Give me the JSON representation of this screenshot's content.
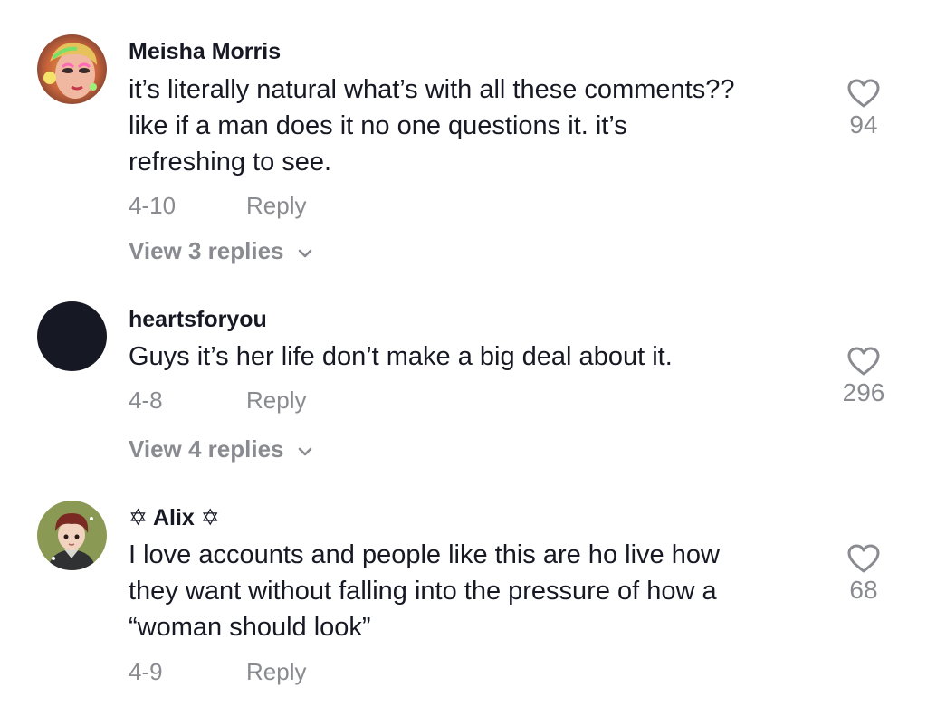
{
  "comments": [
    {
      "username": "Meisha Morris",
      "text": "it’s literally natural what’s with all these comments??\nlike if a man does it no one questions it. it’s\nrefreshing to see.",
      "date": "4-10",
      "reply_label": "Reply",
      "view_replies": "View 3 replies",
      "likes": "94"
    },
    {
      "username": "heartsforyou",
      "text": "Guys it’s her life don’t make a big deal about it.",
      "date": "4-8",
      "reply_label": "Reply",
      "view_replies": "View 4 replies",
      "likes": "296"
    },
    {
      "username": "✡ Alix ✡",
      "text": "I love accounts and people like this are ho live how\nthey want without falling into the pressure of how a\n“woman should look”",
      "date": "4-9",
      "reply_label": "Reply",
      "likes": "68"
    }
  ],
  "icons": {
    "like": "heart-outline-icon",
    "expand": "chevron-down-icon"
  },
  "colors": {
    "text": "#161823",
    "secondary": "#8a8b91",
    "avatar_dark": "#161823"
  }
}
